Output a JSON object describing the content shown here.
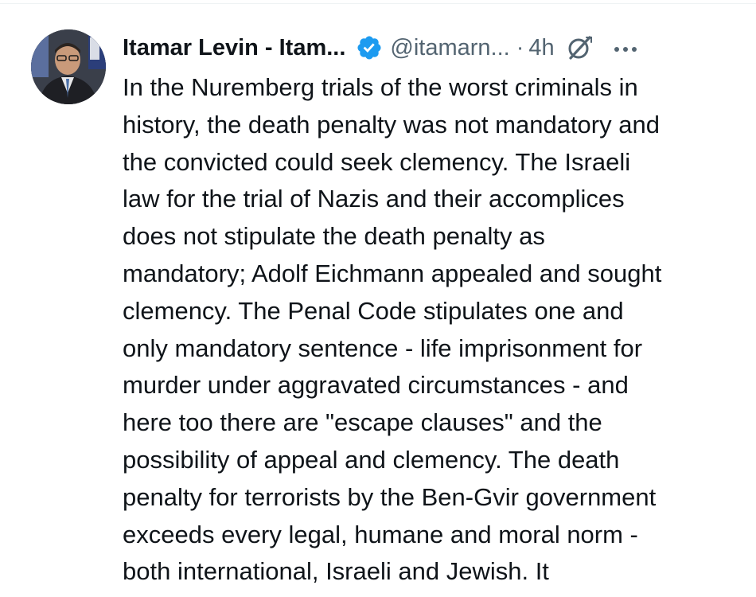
{
  "post": {
    "author": {
      "display_name": "Itamar Levin - Itam...",
      "handle": "@itamarn...",
      "verified": true,
      "avatar": "avatar-photo"
    },
    "separator": "·",
    "time": "4h",
    "icons": {
      "verified": "verified-badge-icon",
      "grok": "grok-icon",
      "more": "more-options-icon"
    },
    "colors": {
      "verified_blue": "#1d9bf0",
      "text": "#0f1419",
      "secondary_text": "#536471"
    },
    "text": "In the Nuremberg trials of the worst criminals in\nhistory, the death penalty was not mandatory and\nthe convicted could seek clemency. The Israeli\nlaw for the trial of Nazis and their accomplices\ndoes not stipulate the death penalty as\nmandatory; Adolf Eichmann appealed and sought\nclemency. The Penal Code stipulates one and\nonly mandatory sentence - life imprisonment for\nmurder under aggravated circumstances - and\nhere too there are \"escape clauses\" and the\npossibility of appeal and clemency. The death\npenalty for terrorists by the Ben-Gvir government\nexceeds every legal, humane and moral norm -\nboth international, Israeli and Jewish. It"
  }
}
